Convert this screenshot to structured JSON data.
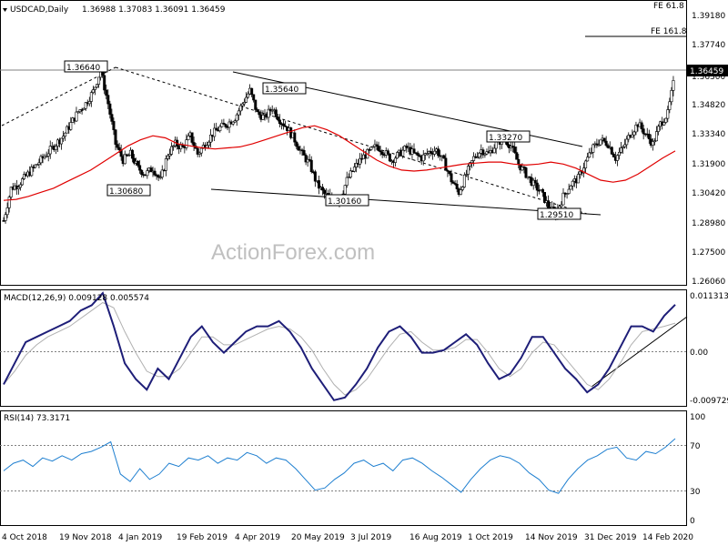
{
  "header": {
    "symbol_label": "USDCAD,Daily",
    "ohlc_text": "1.36988 1.37083 1.36091 1.36459"
  },
  "watermark": "ActionForex.com",
  "price_panel": {
    "y_ticks": [
      "1.39180",
      "1.37740",
      "1.36300",
      "1.34820",
      "1.33340",
      "1.31900",
      "1.30420",
      "1.28980",
      "1.27500",
      "1.26060"
    ],
    "current_price": "1.36459",
    "fib_labels": [
      "FE 61.8",
      "FE 161.8"
    ],
    "annotations": [
      "1.36640",
      "1.35640",
      "1.33270",
      "1.30680",
      "1.30160",
      "1.29510"
    ]
  },
  "macd_panel": {
    "label": "MACD(12,26,9) 0.009128 0.005574",
    "y_ticks": [
      "0.011313",
      "0.00",
      "-0.009729"
    ]
  },
  "rsi_panel": {
    "label": "RSI(14) 73.3171",
    "y_ticks": [
      "100",
      "70",
      "30",
      "0"
    ]
  },
  "x_axis": [
    "4 Oct 2018",
    "19 Nov 2018",
    "4 Jan 2019",
    "19 Feb 2019",
    "4 Apr 2019",
    "20 May 2019",
    "3 Jul 2019",
    "16 Aug 2019",
    "1 Oct 2019",
    "14 Nov 2019",
    "31 Dec 2019",
    "14 Feb 2020"
  ],
  "chart_data": [
    {
      "type": "line",
      "title": "USDCAD,Daily",
      "note": "candlestick price panel with 55-day moving average; values approximated from the axis",
      "x_dates": [
        "4 Oct 2018",
        "19 Nov 2018",
        "4 Jan 2019",
        "19 Feb 2019",
        "4 Apr 2019",
        "20 May 2019",
        "3 Jul 2019",
        "16 Aug 2019",
        "1 Oct 2019",
        "14 Nov 2019",
        "31 Dec 2019",
        "14 Feb 2020"
      ],
      "ylim": [
        1.2606,
        1.3995
      ],
      "series": [
        {
          "values": [
            1.292,
            1.308,
            1.31,
            1.314,
            1.318,
            1.322,
            1.326,
            1.33,
            1.334,
            1.34,
            1.346,
            1.35,
            1.356,
            1.3664,
            1.35,
            1.33,
            1.322,
            1.325,
            1.318,
            1.315,
            1.318,
            1.312,
            1.325,
            1.33,
            1.328,
            1.334,
            1.325,
            1.33,
            1.335,
            1.338,
            1.34,
            1.343,
            1.35,
            1.3564,
            1.345,
            1.343,
            1.348,
            1.342,
            1.338,
            1.332,
            1.325,
            1.32,
            1.31,
            1.305,
            1.303,
            1.3016,
            1.312,
            1.318,
            1.323,
            1.326,
            1.329,
            1.326,
            1.322,
            1.325,
            1.328,
            1.325,
            1.323,
            1.326,
            1.327,
            1.321,
            1.312,
            1.306,
            1.315,
            1.323,
            1.327,
            1.325,
            1.33,
            1.3327,
            1.329,
            1.32,
            1.315,
            1.31,
            1.306,
            1.299,
            1.2951,
            1.304,
            1.31,
            1.313,
            1.321,
            1.328,
            1.332,
            1.33,
            1.323,
            1.328,
            1.335,
            1.34,
            1.335,
            1.33,
            1.34,
            1.345,
            1.3646
          ]
        },
        {
          "values": [
            1.302,
            1.3025,
            1.304,
            1.306,
            1.308,
            1.311,
            1.314,
            1.317,
            1.321,
            1.325,
            1.329,
            1.332,
            1.334,
            1.333,
            1.33,
            1.329,
            1.328,
            1.3275,
            1.328,
            1.3285,
            1.33,
            1.332,
            1.334,
            1.336,
            1.338,
            1.339,
            1.337,
            1.334,
            1.33,
            1.326,
            1.322,
            1.319,
            1.317,
            1.3165,
            1.317,
            1.318,
            1.319,
            1.32,
            1.3205,
            1.321,
            1.321,
            1.32,
            1.3195,
            1.32,
            1.321,
            1.32,
            1.318,
            1.315,
            1.312,
            1.311,
            1.312,
            1.315,
            1.319,
            1.323,
            1.3265
          ]
        }
      ]
    },
    {
      "type": "line",
      "title": "MACD(12,26,9) 0.009128 0.005574",
      "ylim": [
        -0.009729,
        0.011313
      ],
      "series": [
        {
          "values": [
            -0.006,
            -0.002,
            0.002,
            0.003,
            0.004,
            0.005,
            0.006,
            0.008,
            0.009,
            0.0113,
            0.005,
            -0.002,
            -0.005,
            -0.007,
            -0.003,
            -0.005,
            -0.001,
            0.003,
            0.005,
            0.002,
            0.0,
            0.002,
            0.004,
            0.005,
            0.005,
            0.006,
            0.004,
            0.001,
            -0.003,
            -0.006,
            -0.009,
            -0.0085,
            -0.006,
            -0.003,
            0.001,
            0.004,
            0.005,
            0.003,
            0.0,
            0.0,
            0.0005,
            0.002,
            0.0035,
            0.0015,
            -0.002,
            -0.005,
            -0.004,
            -0.001,
            0.003,
            0.003,
            0.0,
            -0.003,
            -0.005,
            -0.0075,
            -0.006,
            -0.003,
            0.001,
            0.005,
            0.005,
            0.004,
            0.007,
            0.0091
          ]
        },
        {
          "values": [
            -0.006,
            -0.0035,
            -0.0005,
            0.0015,
            0.003,
            0.004,
            0.005,
            0.0065,
            0.008,
            0.0095,
            0.0085,
            0.004,
            0.0,
            -0.0035,
            -0.0045,
            -0.0045,
            -0.003,
            0.0,
            0.003,
            0.003,
            0.0015,
            0.0015,
            0.0025,
            0.0035,
            0.0045,
            0.005,
            0.0045,
            0.003,
            0.0005,
            -0.003,
            -0.006,
            -0.008,
            -0.007,
            -0.005,
            -0.002,
            0.001,
            0.0035,
            0.004,
            0.002,
            0.0005,
            0.0005,
            0.001,
            0.0025,
            0.0025,
            0.0,
            -0.003,
            -0.0045,
            -0.003,
            0.0,
            0.002,
            0.0015,
            -0.001,
            -0.0035,
            -0.006,
            -0.007,
            -0.005,
            -0.002,
            0.0015,
            0.004,
            0.0045,
            0.005,
            0.0056
          ]
        }
      ]
    },
    {
      "type": "line",
      "title": "RSI(14) 73.3171",
      "ylim": [
        0,
        100
      ],
      "series": [
        {
          "values": [
            48,
            55,
            58,
            52,
            60,
            57,
            62,
            58,
            64,
            66,
            70,
            75,
            45,
            38,
            50,
            40,
            45,
            55,
            52,
            60,
            58,
            62,
            55,
            60,
            58,
            65,
            62,
            55,
            60,
            58,
            50,
            40,
            30,
            32,
            40,
            46,
            55,
            58,
            52,
            55,
            48,
            58,
            60,
            55,
            48,
            42,
            35,
            28,
            40,
            50,
            58,
            62,
            60,
            55,
            46,
            40,
            30,
            27,
            40,
            50,
            58,
            62,
            68,
            70,
            60,
            58,
            66,
            64,
            70,
            78
          ]
        }
      ]
    }
  ]
}
